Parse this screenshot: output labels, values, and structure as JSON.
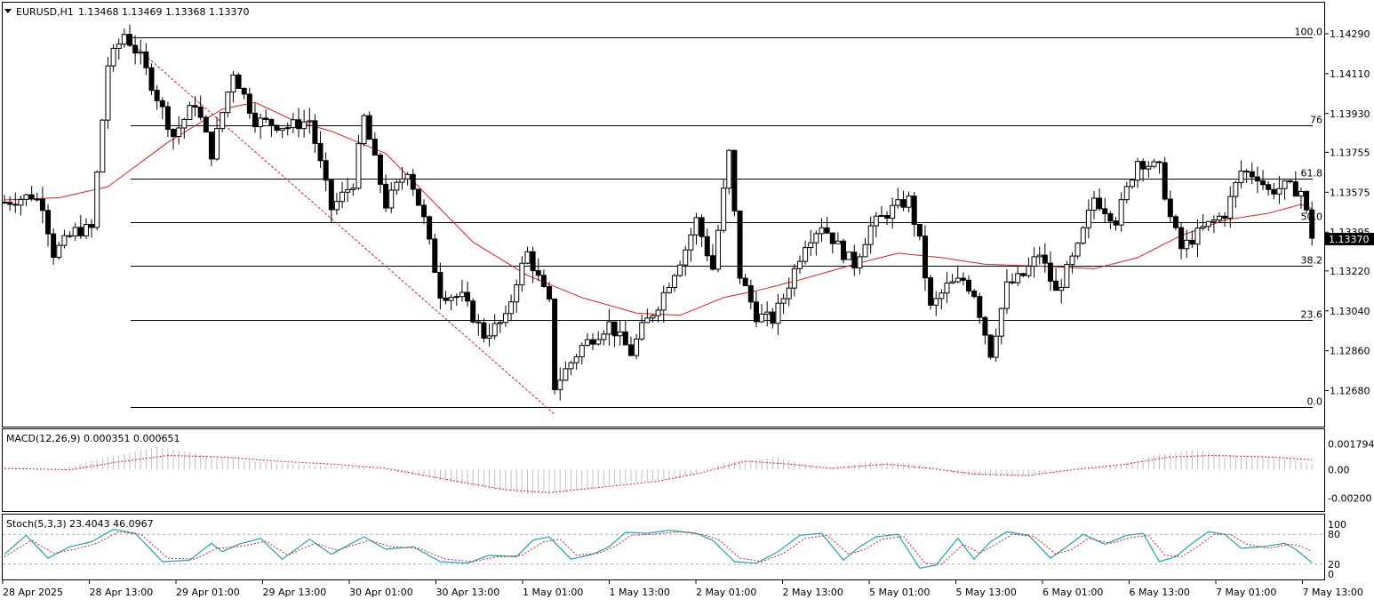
{
  "colors": {
    "background": "#ffffff",
    "grid_line": "#000000",
    "bull_candle": "#ffffff",
    "bear_candle": "#000000",
    "ma_line": "#e31a1c",
    "fib_trend": "#e31a1c",
    "macd_hist": "#c0c0c0",
    "macd_signal": "#e31a1c",
    "stoch_main": "#1aa3b8",
    "stoch_signal": "#e31a1c",
    "price_tag_bg": "#000000",
    "price_tag_fg": "#ffffff"
  },
  "header": {
    "symbol": "EURUSD,H1",
    "ohlc": "1.13468 1.13469 1.13368 1.13370",
    "menu_icon": "triangle-down-icon"
  },
  "price_axis": {
    "ticks": [
      "1.14290",
      "1.14110",
      "1.13930",
      "1.13755",
      "1.13575",
      "1.13395",
      "1.13220",
      "1.13040",
      "1.12860",
      "1.12680"
    ],
    "current_price": "1.13370"
  },
  "fibonacci": {
    "levels": [
      {
        "label": "100.0",
        "price": 1.14275
      },
      {
        "label": "76",
        "price": 1.13875
      },
      {
        "label": "61.8",
        "price": 1.13637
      },
      {
        "label": "50.0",
        "price": 1.1344
      },
      {
        "label": "38.2",
        "price": 1.13243
      },
      {
        "label": "23.6",
        "price": 1.12998
      },
      {
        "label": "0.0",
        "price": 1.12605
      }
    ]
  },
  "macd": {
    "label": "MACD(12,26,9) 0.000351 0.000651",
    "ticks": [
      "0.001794",
      "0.00",
      "-0.00200"
    ]
  },
  "stoch": {
    "label": "Stoch(5,3,3) 23.4043 46.0967",
    "ticks": [
      "100",
      "80",
      "20",
      "0"
    ]
  },
  "time_axis": {
    "labels": [
      "28 Apr 2025",
      "28 Apr 13:00",
      "29 Apr 01:00",
      "29 Apr 13:00",
      "30 Apr 01:00",
      "30 Apr 13:00",
      "1 May 01:00",
      "1 May 13:00",
      "2 May 01:00",
      "2 May 13:00",
      "5 May 01:00",
      "5 May 13:00",
      "6 May 01:00",
      "6 May 13:00",
      "7 May 01:00",
      "7 May 13:00"
    ]
  },
  "chart_data": {
    "type": "candlestick",
    "symbol": "EURUSD",
    "timeframe": "H1",
    "ylim": [
      1.1259,
      1.1437
    ],
    "anchors": [
      [
        0,
        1.1353
      ],
      [
        5,
        1.1356
      ],
      [
        7,
        1.1352
      ],
      [
        9,
        1.133
      ],
      [
        13,
        1.134
      ],
      [
        16,
        1.1341
      ],
      [
        19,
        1.1415
      ],
      [
        22,
        1.1429
      ],
      [
        25,
        1.1418
      ],
      [
        31,
        1.1383
      ],
      [
        35,
        1.1398
      ],
      [
        38,
        1.1375
      ],
      [
        42,
        1.1412
      ],
      [
        46,
        1.139
      ],
      [
        52,
        1.1387
      ],
      [
        56,
        1.139
      ],
      [
        60,
        1.135
      ],
      [
        64,
        1.1362
      ],
      [
        66,
        1.1391
      ],
      [
        70,
        1.1352
      ],
      [
        74,
        1.1368
      ],
      [
        77,
        1.1345
      ],
      [
        80,
        1.1312
      ],
      [
        84,
        1.131
      ],
      [
        88,
        1.1293
      ],
      [
        92,
        1.13
      ],
      [
        94,
        1.1318
      ],
      [
        96,
        1.133
      ],
      [
        100,
        1.1307
      ],
      [
        101,
        1.127
      ],
      [
        106,
        1.1288
      ],
      [
        111,
        1.1298
      ],
      [
        115,
        1.1285
      ],
      [
        117,
        1.1296
      ],
      [
        120,
        1.1307
      ],
      [
        125,
        1.1332
      ],
      [
        127,
        1.1345
      ],
      [
        130,
        1.1323
      ],
      [
        133,
        1.1375
      ],
      [
        135,
        1.132
      ],
      [
        138,
        1.1302
      ],
      [
        141,
        1.13
      ],
      [
        143,
        1.131
      ],
      [
        147,
        1.1335
      ],
      [
        150,
        1.1343
      ],
      [
        154,
        1.133
      ],
      [
        156,
        1.1325
      ],
      [
        159,
        1.1342
      ],
      [
        163,
        1.135
      ],
      [
        166,
        1.1354
      ],
      [
        168,
        1.1335
      ],
      [
        170,
        1.1305
      ],
      [
        173,
        1.1315
      ],
      [
        176,
        1.1318
      ],
      [
        178,
        1.1312
      ],
      [
        181,
        1.1285
      ],
      [
        184,
        1.1315
      ],
      [
        187,
        1.132
      ],
      [
        190,
        1.133
      ],
      [
        193,
        1.1312
      ],
      [
        197,
        1.1332
      ],
      [
        200,
        1.1355
      ],
      [
        204,
        1.1345
      ],
      [
        208,
        1.1372
      ],
      [
        212,
        1.1368
      ],
      [
        214,
        1.1346
      ],
      [
        216,
        1.1332
      ],
      [
        220,
        1.1341
      ],
      [
        224,
        1.1348
      ],
      [
        227,
        1.1367
      ],
      [
        230,
        1.1365
      ],
      [
        232,
        1.1358
      ],
      [
        235,
        1.136
      ],
      [
        238,
        1.1358
      ],
      [
        240,
        1.1338
      ]
    ],
    "moving_average": [
      [
        0,
        1.1354
      ],
      [
        10,
        1.1355
      ],
      [
        19,
        1.136
      ],
      [
        30,
        1.138
      ],
      [
        40,
        1.1395
      ],
      [
        46,
        1.1398
      ],
      [
        53,
        1.139
      ],
      [
        60,
        1.1385
      ],
      [
        70,
        1.1375
      ],
      [
        78,
        1.1355
      ],
      [
        86,
        1.1335
      ],
      [
        96,
        1.132
      ],
      [
        106,
        1.131
      ],
      [
        116,
        1.1303
      ],
      [
        124,
        1.1302
      ],
      [
        132,
        1.131
      ],
      [
        138,
        1.1313
      ],
      [
        146,
        1.1318
      ],
      [
        156,
        1.1325
      ],
      [
        164,
        1.133
      ],
      [
        172,
        1.1328
      ],
      [
        180,
        1.1325
      ],
      [
        192,
        1.1324
      ],
      [
        200,
        1.1323
      ],
      [
        208,
        1.1328
      ],
      [
        216,
        1.1338
      ],
      [
        224,
        1.1345
      ],
      [
        232,
        1.1348
      ],
      [
        238,
        1.1352
      ],
      [
        240,
        1.135
      ]
    ],
    "fib_trendline": [
      [
        22,
        1.14275
      ],
      [
        101,
        1.12605
      ]
    ],
    "macd": {
      "ylim": [
        -0.0027,
        0.0024
      ],
      "histogram_anchors": [
        [
          0,
          0.0001
        ],
        [
          10,
          0.0
        ],
        [
          19,
          0.0009
        ],
        [
          28,
          0.0016
        ],
        [
          36,
          0.0011
        ],
        [
          46,
          0.0006
        ],
        [
          56,
          0.0003
        ],
        [
          66,
          0.0002
        ],
        [
          76,
          -0.0004
        ],
        [
          86,
          -0.0012
        ],
        [
          96,
          -0.0017
        ],
        [
          104,
          -0.0015
        ],
        [
          114,
          -0.0009
        ],
        [
          124,
          -0.0006
        ],
        [
          132,
          0.0005
        ],
        [
          142,
          0.0009
        ],
        [
          150,
          0.0001
        ],
        [
          160,
          0.0006
        ],
        [
          168,
          0.0004
        ],
        [
          176,
          -0.0004
        ],
        [
          186,
          -0.0005
        ],
        [
          196,
          0.0
        ],
        [
          204,
          0.0003
        ],
        [
          212,
          0.0011
        ],
        [
          218,
          0.0014
        ],
        [
          226,
          0.001
        ],
        [
          234,
          0.0009
        ],
        [
          240,
          0.0004
        ]
      ],
      "signal_anchors": [
        [
          0,
          0.0001
        ],
        [
          12,
          0.0
        ],
        [
          20,
          0.0005
        ],
        [
          30,
          0.001
        ],
        [
          40,
          0.0009
        ],
        [
          50,
          0.0006
        ],
        [
          60,
          0.0004
        ],
        [
          70,
          0.0001
        ],
        [
          80,
          -0.0006
        ],
        [
          92,
          -0.0014
        ],
        [
          100,
          -0.0016
        ],
        [
          110,
          -0.0012
        ],
        [
          120,
          -0.0008
        ],
        [
          128,
          -0.0002
        ],
        [
          136,
          0.0006
        ],
        [
          144,
          0.0004
        ],
        [
          152,
          0.0001
        ],
        [
          162,
          0.0004
        ],
        [
          170,
          0.0001
        ],
        [
          178,
          -0.0003
        ],
        [
          188,
          -0.0004
        ],
        [
          196,
          0.0
        ],
        [
          206,
          0.0004
        ],
        [
          214,
          0.0009
        ],
        [
          222,
          0.001
        ],
        [
          232,
          0.0009
        ],
        [
          240,
          0.0007
        ]
      ]
    },
    "stochastic": {
      "ylim": [
        0,
        100
      ],
      "levels": [
        20,
        80
      ],
      "main_anchors": [
        [
          0,
          40
        ],
        [
          4,
          78
        ],
        [
          8,
          32
        ],
        [
          12,
          55
        ],
        [
          16,
          65
        ],
        [
          20,
          90
        ],
        [
          24,
          82
        ],
        [
          29,
          25
        ],
        [
          34,
          28
        ],
        [
          38,
          62
        ],
        [
          40,
          45
        ],
        [
          43,
          60
        ],
        [
          47,
          72
        ],
        [
          51,
          30
        ],
        [
          56,
          70
        ],
        [
          60,
          40
        ],
        [
          66,
          75
        ],
        [
          70,
          50
        ],
        [
          75,
          55
        ],
        [
          80,
          25
        ],
        [
          85,
          22
        ],
        [
          89,
          38
        ],
        [
          94,
          35
        ],
        [
          97,
          68
        ],
        [
          100,
          75
        ],
        [
          104,
          30
        ],
        [
          108,
          40
        ],
        [
          111,
          55
        ],
        [
          114,
          84
        ],
        [
          118,
          82
        ],
        [
          122,
          88
        ],
        [
          127,
          82
        ],
        [
          130,
          68
        ],
        [
          134,
          25
        ],
        [
          138,
          22
        ],
        [
          142,
          45
        ],
        [
          146,
          78
        ],
        [
          150,
          82
        ],
        [
          154,
          28
        ],
        [
          157,
          55
        ],
        [
          160,
          75
        ],
        [
          164,
          80
        ],
        [
          168,
          12
        ],
        [
          171,
          18
        ],
        [
          175,
          72
        ],
        [
          178,
          30
        ],
        [
          181,
          65
        ],
        [
          184,
          85
        ],
        [
          188,
          78
        ],
        [
          192,
          32
        ],
        [
          195,
          55
        ],
        [
          198,
          80
        ],
        [
          202,
          60
        ],
        [
          206,
          78
        ],
        [
          209,
          82
        ],
        [
          212,
          25
        ],
        [
          215,
          35
        ],
        [
          218,
          62
        ],
        [
          221,
          85
        ],
        [
          224,
          80
        ],
        [
          227,
          52
        ],
        [
          231,
          55
        ],
        [
          235,
          62
        ],
        [
          237,
          50
        ],
        [
          240,
          23
        ]
      ],
      "signal_anchors": [
        [
          0,
          35
        ],
        [
          5,
          68
        ],
        [
          9,
          42
        ],
        [
          13,
          50
        ],
        [
          17,
          62
        ],
        [
          21,
          85
        ],
        [
          25,
          80
        ],
        [
          30,
          32
        ],
        [
          35,
          30
        ],
        [
          39,
          52
        ],
        [
          43,
          55
        ],
        [
          48,
          66
        ],
        [
          52,
          38
        ],
        [
          57,
          62
        ],
        [
          61,
          48
        ],
        [
          67,
          68
        ],
        [
          71,
          55
        ],
        [
          76,
          52
        ],
        [
          81,
          30
        ],
        [
          86,
          25
        ],
        [
          90,
          34
        ],
        [
          95,
          38
        ],
        [
          99,
          65
        ],
        [
          102,
          70
        ],
        [
          105,
          38
        ],
        [
          109,
          42
        ],
        [
          112,
          55
        ],
        [
          115,
          78
        ],
        [
          119,
          80
        ],
        [
          124,
          85
        ],
        [
          128,
          80
        ],
        [
          131,
          70
        ],
        [
          135,
          32
        ],
        [
          139,
          25
        ],
        [
          143,
          42
        ],
        [
          147,
          72
        ],
        [
          151,
          78
        ],
        [
          155,
          40
        ],
        [
          158,
          50
        ],
        [
          161,
          70
        ],
        [
          165,
          76
        ],
        [
          169,
          22
        ],
        [
          172,
          20
        ],
        [
          176,
          60
        ],
        [
          179,
          42
        ],
        [
          182,
          60
        ],
        [
          185,
          80
        ],
        [
          189,
          76
        ],
        [
          193,
          40
        ],
        [
          196,
          50
        ],
        [
          199,
          72
        ],
        [
          203,
          62
        ],
        [
          207,
          74
        ],
        [
          210,
          78
        ],
        [
          213,
          38
        ],
        [
          216,
          35
        ],
        [
          219,
          55
        ],
        [
          222,
          80
        ],
        [
          225,
          80
        ],
        [
          228,
          60
        ],
        [
          232,
          52
        ],
        [
          236,
          60
        ],
        [
          238,
          55
        ],
        [
          240,
          46
        ]
      ]
    }
  }
}
